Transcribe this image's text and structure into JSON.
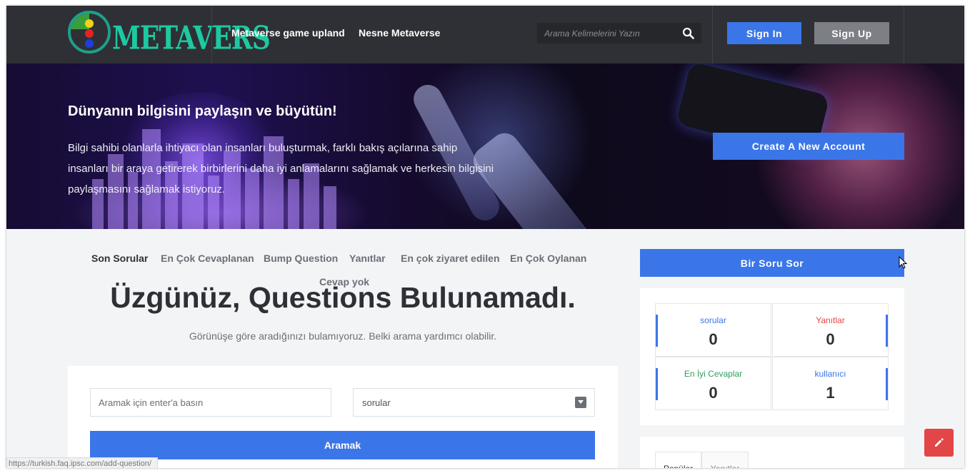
{
  "header": {
    "logo_text": "METAVERS",
    "nav": [
      {
        "label": "Metaverse game upland"
      },
      {
        "label": "Nesne Metaverse"
      }
    ],
    "search_placeholder": "Arama Kelimelerini Yazın",
    "sign_in": "Sign In",
    "sign_up": "Sign Up"
  },
  "hero": {
    "title": "Dünyanın bilgisini paylaşın ve büyütün!",
    "text": "Bilgi sahibi olanlarla ihtiyacı olan insanları buluşturmak, farklı bakış açılarına sahip insanları bir araya getirerek birbirlerini daha iyi anlamalarını sağlamak ve herkesin bilgisini paylaşmasını sağlamak istiyoruz.",
    "cta": "Create A New Account"
  },
  "tabs": [
    {
      "label": "Son Sorular",
      "active": true
    },
    {
      "label": "En Çok Cevaplanan"
    },
    {
      "label": "Bump Question"
    },
    {
      "label": "Yanıtlar"
    },
    {
      "label": "En çok ziyaret edilen"
    },
    {
      "label": "En Çok Oylanan"
    },
    {
      "label": "Cevap yok"
    }
  ],
  "empty_state": {
    "title": "Üzgünüz, Questions Bulunamadı.",
    "subtitle": "Görünüşe göre aradığınızı bulamıyoruz. Belki arama yardımcı olabilir."
  },
  "search_form": {
    "placeholder": "Aramak için enter'a basın",
    "select_value": "sorular",
    "button": "Aramak"
  },
  "sidebar": {
    "ask_button": "Bir Soru Sor",
    "stats": [
      {
        "label": "sorular",
        "value": "0",
        "color": "#3b76e8"
      },
      {
        "label": "Yanıtlar",
        "value": "0",
        "color": "#e24646"
      },
      {
        "label": "En İyi Cevaplar",
        "value": "0",
        "color": "#2e9e5b"
      },
      {
        "label": "kullanıcı",
        "value": "1",
        "color": "#3b76e8"
      }
    ],
    "mini_tabs": [
      {
        "label": "Popüler"
      },
      {
        "label": "Yanıtlar"
      }
    ]
  },
  "status_url": "https://turkish.faq.ipsc.com/add-question/",
  "colors": {
    "accent": "#3b76e8",
    "header_bg": "#2e3035",
    "fab": "#e24646"
  },
  "icons": {
    "search": "search-icon",
    "fab": "pencil-icon"
  }
}
